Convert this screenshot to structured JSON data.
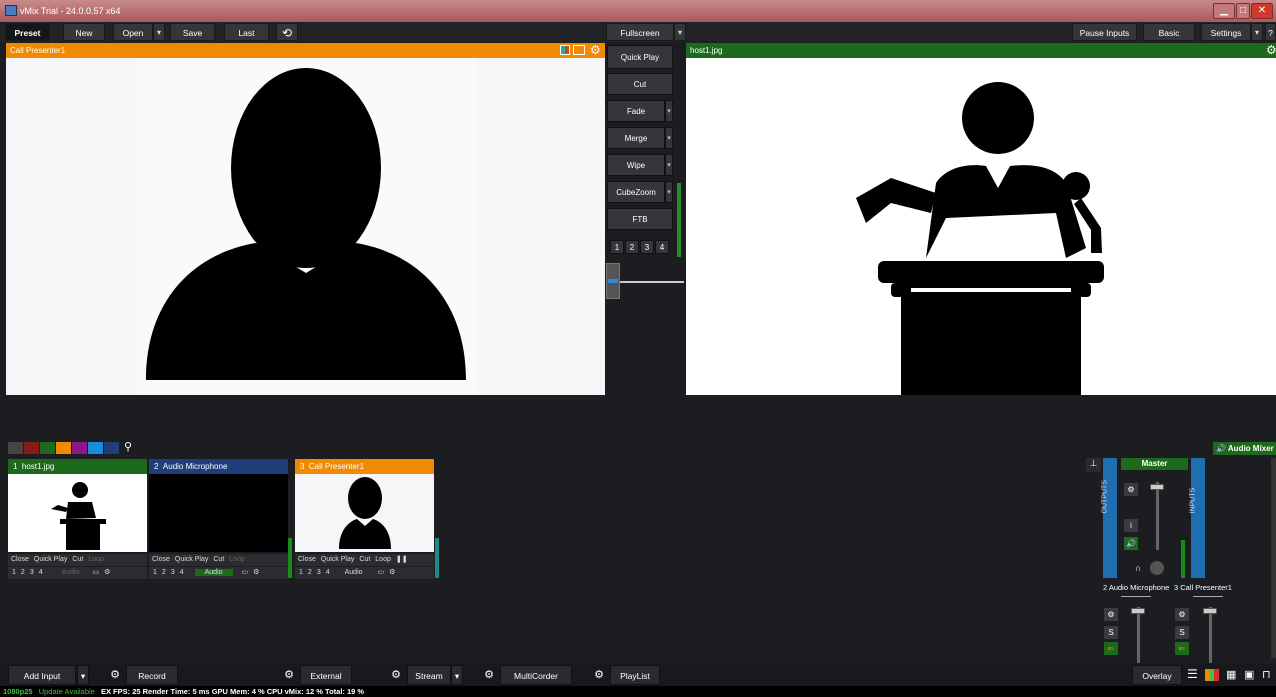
{
  "window": {
    "title": "vMix Trial - 24.0.0.57 x64"
  },
  "toolbar": {
    "preset": "Preset",
    "new": "New",
    "open": "Open",
    "save": "Save",
    "last": "Last",
    "fullscreen": "Fullscreen",
    "pause_inputs": "Pause Inputs",
    "basic": "Basic",
    "settings": "Settings",
    "help": "?"
  },
  "preview": {
    "title": "Call Presenter1"
  },
  "output": {
    "title": "host1.jpg"
  },
  "transitions": {
    "quick_play": "Quick Play",
    "cut": "Cut",
    "fade": "Fade",
    "merge": "Merge",
    "wipe": "Wipe",
    "cubezoom": "CubeZoom",
    "ftb": "FTB",
    "nums": [
      "1",
      "2",
      "3",
      "4"
    ]
  },
  "inputs": [
    {
      "number": "1",
      "name": "host1.jpg",
      "color": "#1d6a1d"
    },
    {
      "number": "2",
      "name": "Audio Microphone",
      "color": "#1e3f7a"
    },
    {
      "number": "3",
      "name": "Call Presenter1",
      "color": "#f08a00"
    }
  ],
  "tile_controls": {
    "close": "Close",
    "quick_play": "Quick Play",
    "cut": "Cut",
    "loop": "Loop",
    "audio": "Audio",
    "nums": [
      "1",
      "2",
      "3",
      "4"
    ]
  },
  "audio_mixer": {
    "label": "Audio Mixer",
    "master": "Master",
    "outputs": "OUTPUTS",
    "inputs": "INPUTS",
    "ch2": "2  Audio Microphone",
    "ch3": "3  Call Presenter1",
    "s": "S",
    "i": "i"
  },
  "bottom": {
    "add_input": "Add Input",
    "record": "Record",
    "external": "External",
    "stream": "Stream",
    "multicorder": "MultiCorder",
    "playlist": "PlayList",
    "overlay": "Overlay"
  },
  "status": {
    "format": "1080p25",
    "update": "Update Available",
    "stats": "EX  FPS: 25  Render Time: 5 ms  GPU Mem: 4 %  CPU vMix: 12 %  Total: 19 %"
  },
  "colors": {
    "preview_header": "#f08a00",
    "output_header": "#1d6a1d",
    "accent_blue": "#1f6fb0",
    "status_green": "#3ec43e"
  }
}
